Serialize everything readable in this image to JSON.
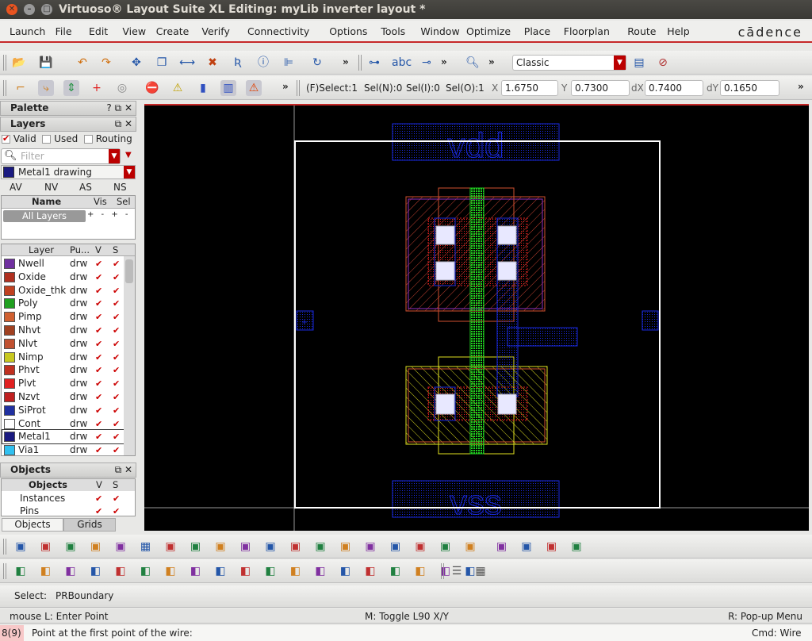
{
  "window": {
    "title": "Virtuoso® Layout Suite XL Editing: myLib inverter layout *"
  },
  "menu": [
    "Launch",
    "File",
    "Edit",
    "View",
    "Create",
    "Verify",
    "Connectivity",
    "Options",
    "Tools",
    "Window",
    "Optimize",
    "Place",
    "Floorplan",
    "Route",
    "Help"
  ],
  "brand": "cādence",
  "toolbar1": {
    "icons": [
      "open-folder-icon",
      "save-icon",
      "undo-icon",
      "redo-icon",
      "move-icon",
      "copy-icon",
      "stretch-icon",
      "delete-icon",
      "rename-icon",
      "info-icon",
      "align-icon",
      "rotate-icon",
      "create-pin-icon",
      "label-icon",
      "via-icon",
      "zoom-icon"
    ],
    "overflow": "»",
    "workspace": "Classic"
  },
  "toolbar2": {
    "select_f": "(F)Select:1",
    "sel_n": "Sel(N):0",
    "sel_i": "Sel(I):0",
    "sel_o": "Sel(O):1",
    "x_label": "X",
    "x": "1.6750",
    "y_label": "Y",
    "y": "0.7300",
    "dx_label": "dX",
    "dx": "0.7400",
    "dy_label": "dY",
    "dy": "0.1650"
  },
  "palette": {
    "title": "Palette"
  },
  "layers": {
    "title": "Layers",
    "valid": "Valid",
    "used": "Used",
    "routing": "Routing",
    "filter_placeholder": "Filter",
    "current": "Metal1 drawing",
    "av": "AV",
    "nv": "NV",
    "as": "AS",
    "ns": "NS",
    "set_cols": [
      "Name",
      "Vis",
      "Sel"
    ],
    "all_layers": "All Layers",
    "cols": [
      "Layer",
      "Pu...",
      "V",
      "S"
    ],
    "rows": [
      {
        "name": "Nwell",
        "p": "drw",
        "color": "#7030a0"
      },
      {
        "name": "Oxide",
        "p": "drw",
        "color": "#b03020"
      },
      {
        "name": "Oxide_thk",
        "p": "drw",
        "color": "#c04020"
      },
      {
        "name": "Poly",
        "p": "drw",
        "color": "#20a020"
      },
      {
        "name": "Pimp",
        "p": "drw",
        "color": "#d06030"
      },
      {
        "name": "Nhvt",
        "p": "drw",
        "color": "#a04020"
      },
      {
        "name": "Nlvt",
        "p": "drw",
        "color": "#c05030"
      },
      {
        "name": "Nimp",
        "p": "drw",
        "color": "#c8c820"
      },
      {
        "name": "Phvt",
        "p": "drw",
        "color": "#c03020"
      },
      {
        "name": "Plvt",
        "p": "drw",
        "color": "#e02020"
      },
      {
        "name": "Nzvt",
        "p": "drw",
        "color": "#c02020"
      },
      {
        "name": "SiProt",
        "p": "drw",
        "color": "#2030a0"
      },
      {
        "name": "Cont",
        "p": "drw",
        "color": "#ffffff"
      },
      {
        "name": "Metal1",
        "p": "drw",
        "color": "#1a1a80",
        "selected": true
      },
      {
        "name": "Via1",
        "p": "drw",
        "color": "#30c0f0"
      }
    ]
  },
  "objects": {
    "title": "Objects",
    "cols": [
      "Objects",
      "V",
      "S"
    ],
    "rows": [
      "Instances",
      "Pins"
    ],
    "tabs": [
      "Objects",
      "Grids"
    ]
  },
  "layout": {
    "labels": {
      "vdd": "vdd",
      "vss": "vss"
    },
    "colors": {
      "metal1": "#1a2ae0",
      "poly": "#20d020",
      "nwell": "#9030c0",
      "pimp": "#d05030",
      "nimp": "#e0e020",
      "active": "#e02020",
      "cont": "#ffffff",
      "boundary": "#ffffff"
    }
  },
  "status": {
    "select_label": "Select:",
    "select_value": "PRBoundary",
    "mouse_l": "mouse L: Enter Point",
    "mouse_m": "M: Toggle L90 X/Y",
    "mouse_r": "R: Pop-up Menu",
    "count": "8(9)",
    "prompt": "Point at the first point of the wire:",
    "cmd": "Cmd: Wire"
  }
}
